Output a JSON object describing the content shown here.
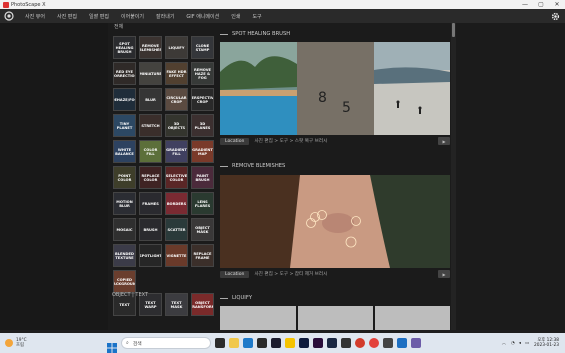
{
  "titlebar": {
    "title": "PhotoScape X",
    "minimize": "—",
    "maximize": "▢",
    "close": "✕"
  },
  "menu": {
    "items": [
      "사진 뷰어",
      "사진 편집",
      "일괄 편집",
      "이어붙이기",
      "잘라내기",
      "GIF 애니메이션",
      "인쇄",
      "도구"
    ]
  },
  "sidebar": {
    "header": "전체",
    "tiles": [
      {
        "label": "SPOT HEALING BRUSH",
        "color": "#2a2b2e"
      },
      {
        "label": "REMOVE BLEMISHES",
        "color": "#3b3330"
      },
      {
        "label": "LIQUIFY",
        "color": "#3d3a37"
      },
      {
        "label": "CLONE STAMP",
        "color": "#34363a"
      },
      {
        "label": "RED EYE CORRECTION",
        "color": "#2f2a28"
      },
      {
        "label": "MINIATURE",
        "color": "#44433f"
      },
      {
        "label": "FAKE HDR EFFECT",
        "color": "#514030"
      },
      {
        "label": "REMOVE HAZE & FOG",
        "color": "#373a38"
      },
      {
        "label": "DEHAZE/FOG",
        "color": "#1f2d3a"
      },
      {
        "label": "BLUR",
        "color": "#353535"
      },
      {
        "label": "CIRCULAR CROP",
        "color": "#5b4b41"
      },
      {
        "label": "PERSPECTIVE CROP",
        "color": "#2a2a2a"
      },
      {
        "label": "TINY PLANET",
        "color": "#2c4863"
      },
      {
        "label": "STRETCH",
        "color": "#3a2e2b"
      },
      {
        "label": "3D OBJECTS",
        "color": "#34352e"
      },
      {
        "label": "3D PLANES",
        "color": "#3c3030"
      },
      {
        "label": "WHITE BALANCE",
        "color": "#2d4260"
      },
      {
        "label": "COLOR FILL",
        "color": "#5c6f3a"
      },
      {
        "label": "GRADIENT FILL",
        "color": "#404060"
      },
      {
        "label": "GRADIENT MAP",
        "color": "#7a3a2a"
      },
      {
        "label": "POINT COLOR",
        "color": "#3e3e2a"
      },
      {
        "label": "REPLACE COLOR",
        "color": "#3f2323"
      },
      {
        "label": "SELECTIVE COLOR",
        "color": "#5a2626"
      },
      {
        "label": "PAINT BRUSH",
        "color": "#4b2a3b"
      },
      {
        "label": "MOTION BLUR",
        "color": "#2b2d33"
      },
      {
        "label": "FRAMES",
        "color": "#2a2a2f"
      },
      {
        "label": "BORDERS",
        "color": "#7a2a32"
      },
      {
        "label": "LENS FLARES",
        "color": "#2a3a30"
      },
      {
        "label": "MOSAIC",
        "color": "#2f2f2f"
      },
      {
        "label": "BRUSH",
        "color": "#2a2a2e"
      },
      {
        "label": "SCATTER",
        "color": "#2a3a3a"
      },
      {
        "label": "OBJECT MASK",
        "color": "#3a3838"
      },
      {
        "label": "BLENDED TEXTURE",
        "color": "#3b3b48"
      },
      {
        "label": "SPOTLIGHT",
        "color": "#262626"
      },
      {
        "label": "VIGNETTE",
        "color": "#6a3a2a"
      },
      {
        "label": "REPLACE FRAME",
        "color": "#3b2f2a"
      },
      {
        "label": "COPIED BACKGROUND",
        "color": "#6a3e2e"
      },
      {
        "label": "TEXT",
        "color": "#2a2a2a"
      },
      {
        "label": "TEXT WARP",
        "color": "#2d2d30"
      },
      {
        "label": "TEXT MASK",
        "color": "#3c3c40"
      },
      {
        "label": "OBJECT TRANSFORM",
        "color": "#7a2a2a"
      }
    ],
    "section2": "OBJECT | TEXT"
  },
  "features": [
    {
      "title": "SPOT HEALING BRUSH",
      "location": "Location",
      "desc": "사진 편집 > 도구 > 스팟 복구 브러시"
    },
    {
      "title": "REMOVE BLEMISHES",
      "location": "Location",
      "desc": "사진 편집 > 도구 > 잡티 제거 브러시"
    },
    {
      "title": "LIQUIFY",
      "location": "",
      "desc": ""
    }
  ],
  "taskbar": {
    "weather_temp": "19°C",
    "weather_desc": "흐림",
    "search_placeholder": "검색",
    "time": "오후 12:38",
    "date": "2023-01-23"
  },
  "icons": {
    "menu_logo": "camera-aperture-icon",
    "settings": "gear-icon",
    "start": "windows-start-icon"
  }
}
